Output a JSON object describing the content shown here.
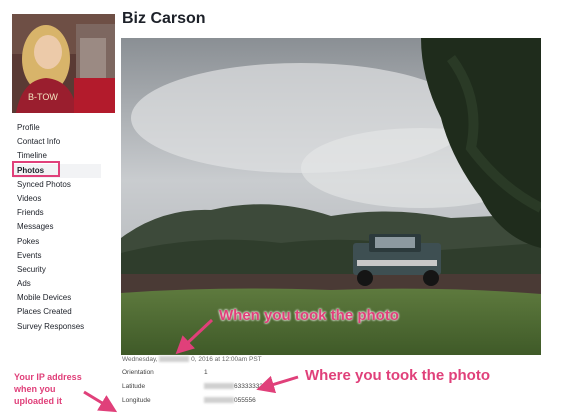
{
  "profile": {
    "name": "Biz Carson"
  },
  "sidebar": {
    "items": [
      {
        "label": "Profile"
      },
      {
        "label": "Contact Info"
      },
      {
        "label": "Timeline"
      },
      {
        "label": "Photos"
      },
      {
        "label": "Synced Photos"
      },
      {
        "label": "Videos"
      },
      {
        "label": "Friends"
      },
      {
        "label": "Messages"
      },
      {
        "label": "Pokes"
      },
      {
        "label": "Events"
      },
      {
        "label": "Security"
      },
      {
        "label": "Ads"
      },
      {
        "label": "Mobile Devices"
      },
      {
        "label": "Places Created"
      },
      {
        "label": "Survey Responses"
      }
    ],
    "active": "Photos"
  },
  "photo_meta": {
    "date_prefix": "Wednesday,",
    "date_suffix": "0, 2016 at 12:00am PST",
    "rows": [
      {
        "label": "Orientation",
        "value": "1"
      },
      {
        "label": "Latitude",
        "value": "633333333"
      },
      {
        "label": "Longitude",
        "value": "055556"
      }
    ]
  },
  "annotations": {
    "when": "When you took the photo",
    "where": "Where you took the photo",
    "ip_line1": "Your IP address",
    "ip_line2": "when you",
    "ip_line3": "uploaded it"
  },
  "colors": {
    "accent": "#e0407a",
    "text": "#1d2129"
  }
}
